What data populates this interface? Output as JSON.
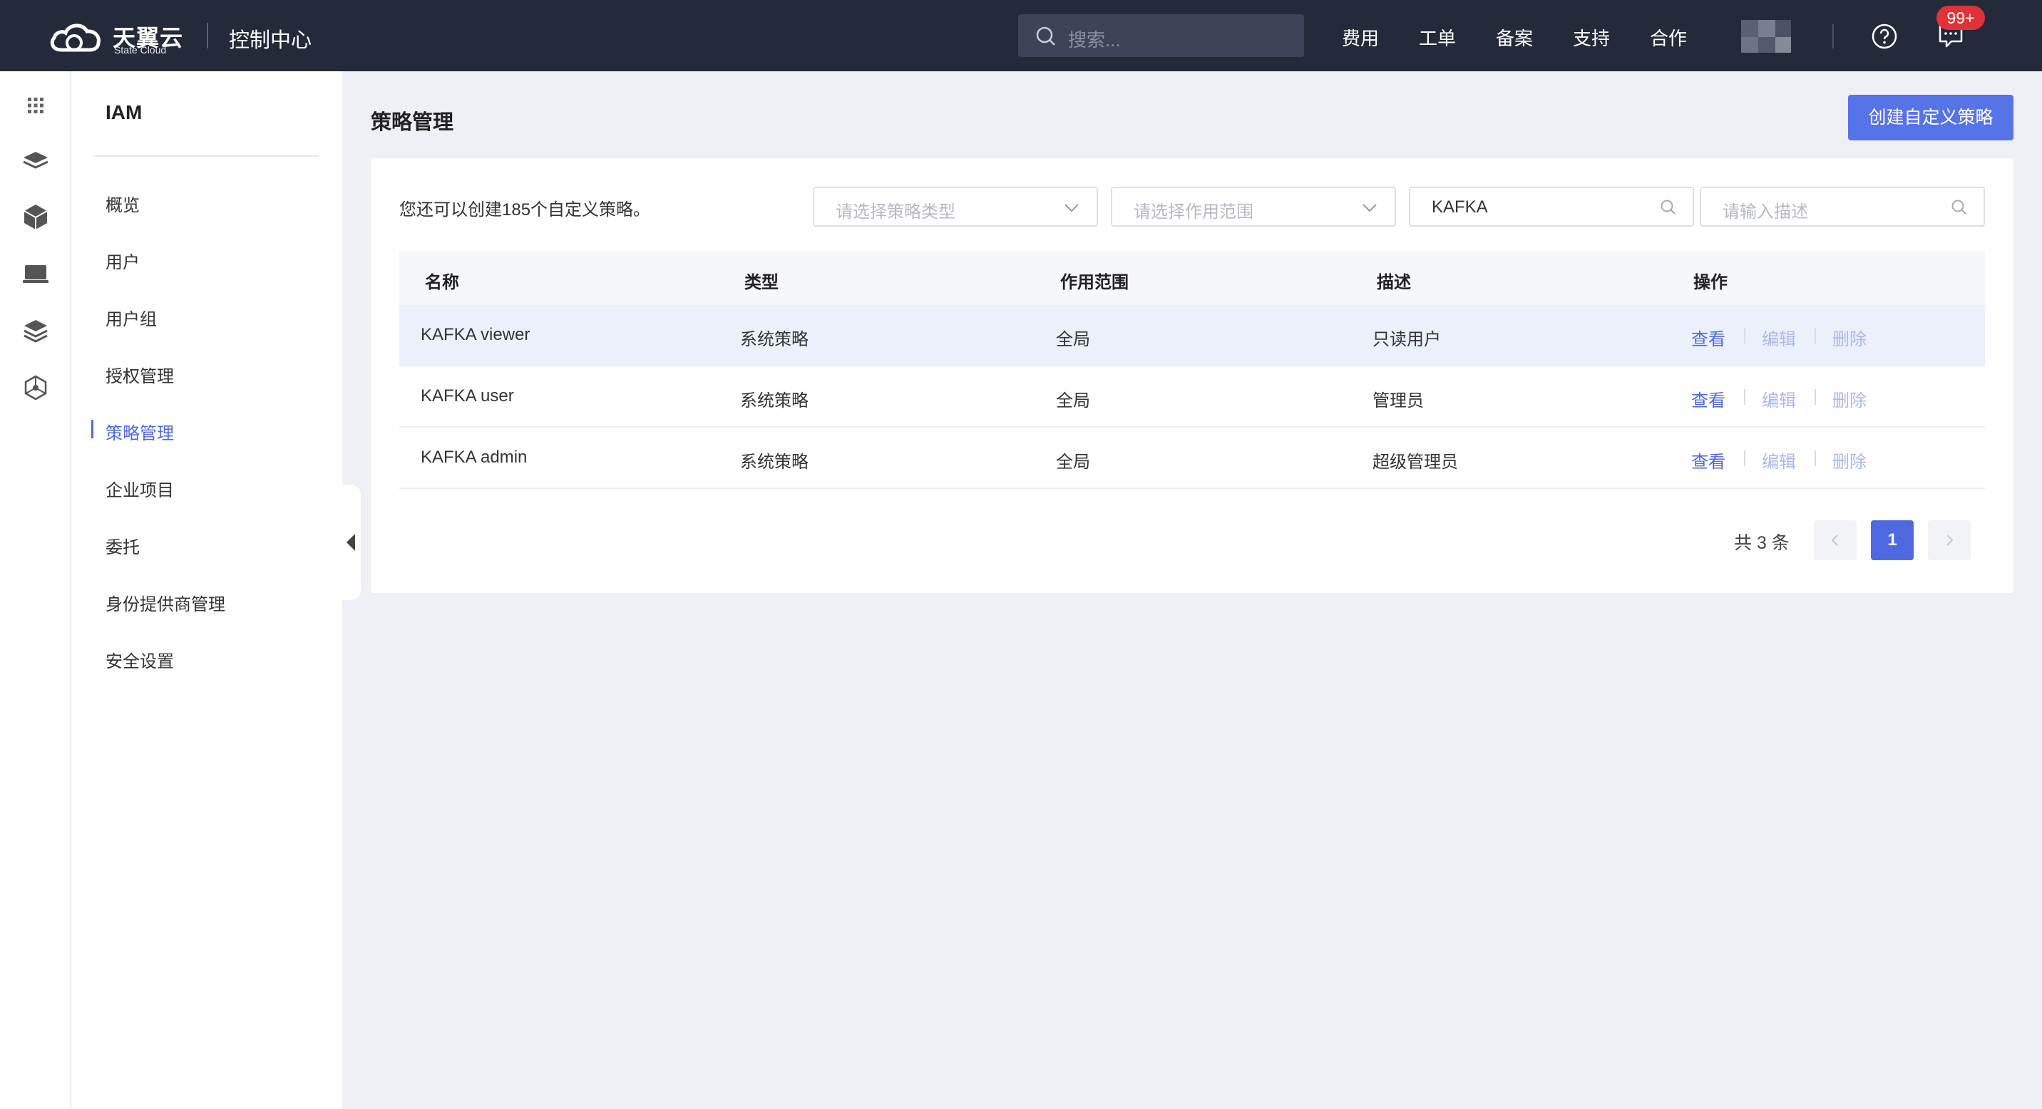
{
  "topbar": {
    "logo_title": "天翼云",
    "logo_sub": "State Cloud",
    "console_title": "控制中心",
    "search_placeholder": "搜索...",
    "nav": [
      "费用",
      "工单",
      "备案",
      "支持",
      "合作"
    ],
    "badge": "99+"
  },
  "rail": {
    "icons": [
      "apps-grid-icon",
      "layers-icon",
      "cube-icon",
      "monitor-icon",
      "stack-icon",
      "network-icon"
    ]
  },
  "sidebar": {
    "title": "IAM",
    "items": [
      {
        "label": "概览"
      },
      {
        "label": "用户"
      },
      {
        "label": "用户组"
      },
      {
        "label": "授权管理"
      },
      {
        "label": "策略管理",
        "active": true
      },
      {
        "label": "企业项目"
      },
      {
        "label": "委托"
      },
      {
        "label": "身份提供商管理"
      },
      {
        "label": "安全设置"
      }
    ]
  },
  "main": {
    "title": "策略管理",
    "create_button": "创建自定义策略",
    "quota_text": "您还可以创建185个自定义策略。",
    "filters": {
      "type_placeholder": "请选择策略类型",
      "scope_placeholder": "请选择作用范围",
      "name_value": "KAFKA",
      "desc_placeholder": "请输入描述"
    },
    "table": {
      "headers": [
        "名称",
        "类型",
        "作用范围",
        "描述",
        "操作"
      ],
      "rows": [
        {
          "name": "KAFKA viewer",
          "type": "系统策略",
          "scope": "全局",
          "desc": "只读用户"
        },
        {
          "name": "KAFKA user",
          "type": "系统策略",
          "scope": "全局",
          "desc": "管理员"
        },
        {
          "name": "KAFKA admin",
          "type": "系统策略",
          "scope": "全局",
          "desc": "超级管理员"
        }
      ],
      "actions": {
        "view": "查看",
        "edit": "编辑",
        "delete": "删除"
      }
    },
    "pagination": {
      "total_text": "共 3 条",
      "current_page": "1"
    }
  },
  "colors": {
    "topbar_bg": "#252a3a",
    "accent": "#4e69e0",
    "button": "#5773e8",
    "badge": "#e0323a",
    "page_bg": "#eef0f5"
  }
}
